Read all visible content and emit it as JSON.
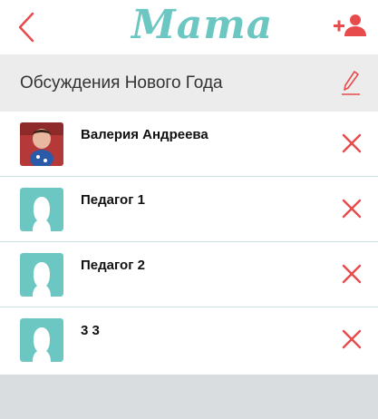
{
  "header": {
    "logo_text": "Мama",
    "back_icon": "chevron-left-icon",
    "add_user_icon": "add-user-icon"
  },
  "chat": {
    "title": "Обсуждения Нового Года",
    "edit_icon": "pencil-icon"
  },
  "participants": [
    {
      "name": "Валерия Андреева",
      "avatar": "photo"
    },
    {
      "name": "Педагог 1",
      "avatar": "placeholder"
    },
    {
      "name": "Педагог 2",
      "avatar": "placeholder"
    },
    {
      "name": "3 3",
      "avatar": "placeholder"
    }
  ],
  "colors": {
    "accent": "#e84b4b",
    "brand": "#6cc7c2",
    "footer": "#d9dde0"
  }
}
